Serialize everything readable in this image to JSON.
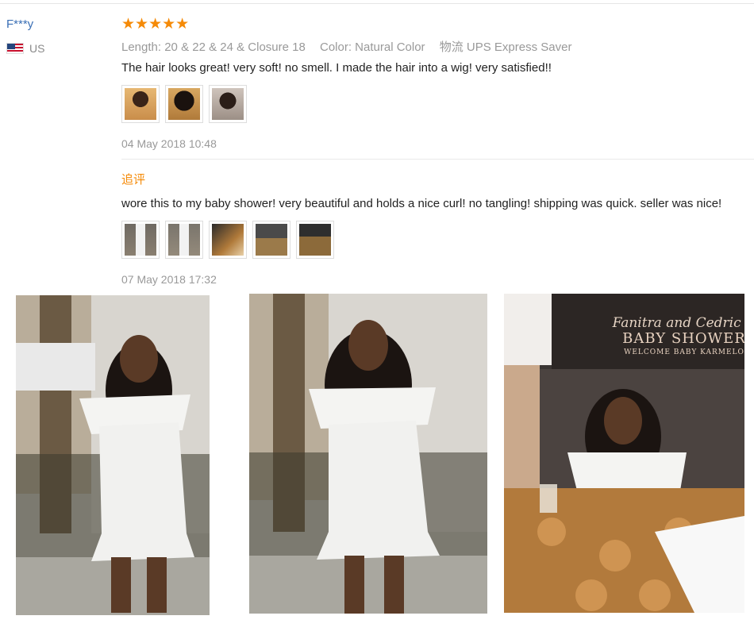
{
  "reviewer": {
    "name": "F***y",
    "country": "US",
    "flag_icon": "us-flag-icon"
  },
  "review": {
    "stars": "★★★★★",
    "star_color": "#f58a07",
    "length": "Length: 20 & 22 & 24 & Closure 18",
    "color": "Color: Natural Color",
    "shipping": "物流 UPS Express Saver",
    "text": "The hair looks great! very soft! no smell. I made the hair into a wig! very satisfied!!",
    "date": "04 May 2018 10:48"
  },
  "followup": {
    "label": "追评",
    "text": "wore this to my baby shower! very beautiful and holds a nice curl! no tangling! shipping was quick. seller was nice!",
    "date": "07 May 2018 17:32"
  },
  "sign": {
    "names": "Fanitra and Cedric 's",
    "title": "BABY SHOWER",
    "subtitle": "WELCOME BABY KARMELO",
    "small": "Fanitra and Cedric's BABY SHOWER"
  },
  "colors": {
    "link": "#3a6fb5",
    "muted": "#999999",
    "accent": "#f58a07"
  }
}
